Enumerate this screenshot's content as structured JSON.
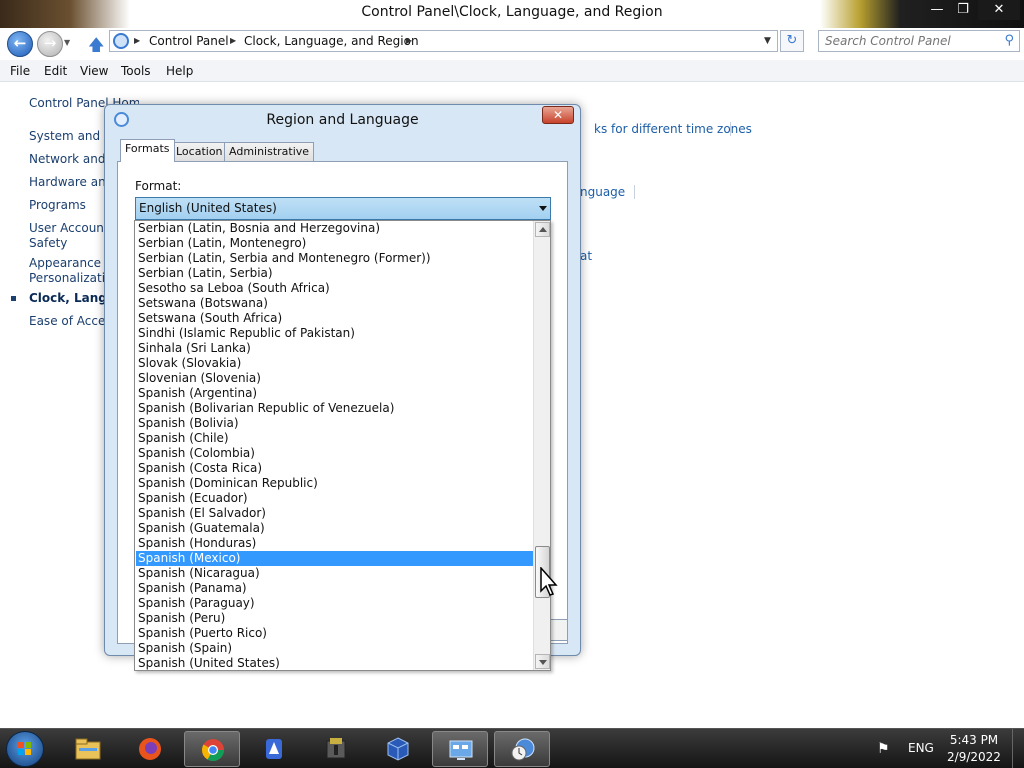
{
  "window": {
    "title": "Control Panel\\Clock, Language, and Region",
    "min_icon": "minimize-icon",
    "max_icon": "restore-icon",
    "close_icon": "close-icon"
  },
  "address": {
    "breadcrumbs": [
      "Control Panel",
      "Clock, Language, and Region"
    ],
    "search_placeholder": "Search Control Panel"
  },
  "menu": [
    "File",
    "Edit",
    "View",
    "Tools",
    "Help"
  ],
  "left_nav": {
    "home": "Control Panel Home",
    "items": [
      "System and Security",
      "Network and Internet",
      "Hardware and Sound",
      "Programs",
      "User Accounts and",
      "Safety",
      "Appearance and",
      "Personalization",
      "Clock, Language, and Region",
      "Ease of Access"
    ]
  },
  "background_links": {
    "time_zones": "ks for different time zones",
    "language": "nguage",
    "format": "at"
  },
  "dialog": {
    "title": "Region and Language",
    "tabs": [
      "Formats",
      "Location",
      "Administrative"
    ],
    "active_tab": "Formats",
    "format_label": "Format:",
    "format_value": "English (United States)",
    "options": [
      "Serbian (Latin, Bosnia and Herzegovina)",
      "Serbian (Latin, Montenegro)",
      "Serbian (Latin, Serbia and Montenegro (Former))",
      "Serbian (Latin, Serbia)",
      "Sesotho sa Leboa (South Africa)",
      "Setswana (Botswana)",
      "Setswana (South Africa)",
      "Sindhi (Islamic Republic of Pakistan)",
      "Sinhala (Sri Lanka)",
      "Slovak (Slovakia)",
      "Slovenian (Slovenia)",
      "Spanish (Argentina)",
      "Spanish (Bolivarian Republic of Venezuela)",
      "Spanish (Bolivia)",
      "Spanish (Chile)",
      "Spanish (Colombia)",
      "Spanish (Costa Rica)",
      "Spanish (Dominican Republic)",
      "Spanish (Ecuador)",
      "Spanish (El Salvador)",
      "Spanish (Guatemala)",
      "Spanish (Honduras)",
      "Spanish (Mexico)",
      "Spanish (Nicaragua)",
      "Spanish (Panama)",
      "Spanish (Paraguay)",
      "Spanish (Peru)",
      "Spanish (Puerto Rico)",
      "Spanish (Spain)",
      "Spanish (United States)"
    ],
    "highlighted_option": "Spanish (Mexico)",
    "highlight_color": "#3399ff"
  },
  "taskbar": {
    "apps": [
      "start-icon",
      "file-explorer-icon",
      "firefox-icon",
      "chrome-icon",
      "app-icon",
      "archive-icon",
      "virtualbox-icon",
      "control-panel-icon",
      "clock-language-icon"
    ],
    "language": "ENG",
    "time": "5:43 PM",
    "date": "2/9/2022"
  }
}
